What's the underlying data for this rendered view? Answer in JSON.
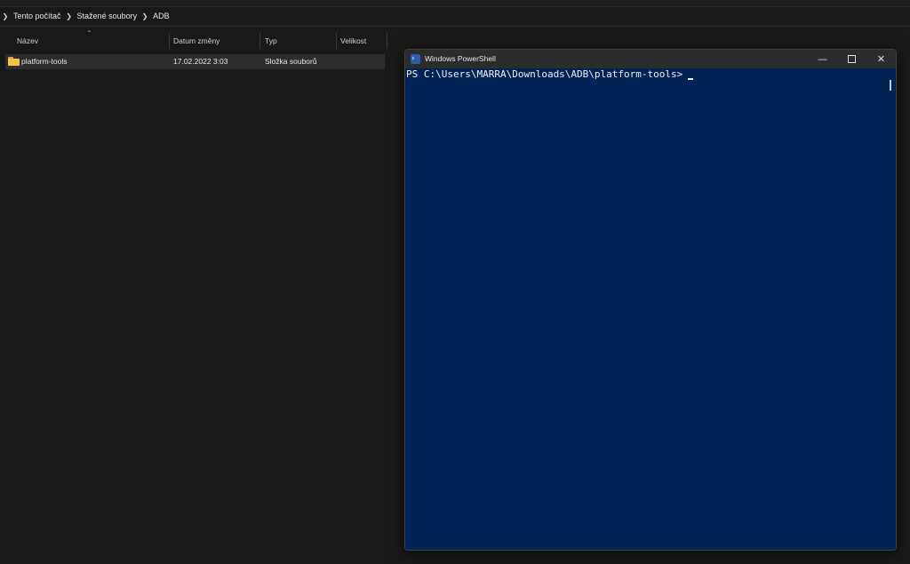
{
  "explorer": {
    "breadcrumb": [
      "Tento počítač",
      "Stažené soubory",
      "ADB"
    ],
    "columns": {
      "name": "Název",
      "date": "Datum změny",
      "type": "Typ",
      "size": "Velikost"
    },
    "files": [
      {
        "name": "platform-tools",
        "date": "17.02.2022 3:03",
        "type": "Složka souborů",
        "size": ""
      }
    ]
  },
  "powershell": {
    "title": "Windows PowerShell",
    "prompt": "PS C:\\Users\\MARRA\\Downloads\\ADB\\platform-tools>",
    "background_color": "#012456"
  },
  "icons": {
    "breadcrumb_separator": "chevron-right-icon",
    "sort": "chevron-up-icon",
    "folder": "folder-icon",
    "powershell": "powershell-icon",
    "minimize": "minimize-icon",
    "maximize": "maximize-icon",
    "close": "close-icon"
  }
}
